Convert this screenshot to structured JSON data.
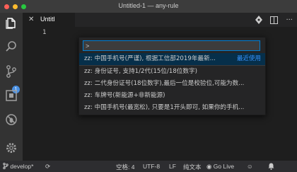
{
  "window": {
    "title": "Untitled-1 — any-rule"
  },
  "tab": {
    "label": "Untitl"
  },
  "editor": {
    "line_number": "1"
  },
  "quick_pick": {
    "input_value": ">",
    "recent_label": "最近使用",
    "items": [
      "zz: 中国手机号(严谨), 根据工信部2019年最新...",
      "zz: 身份证号, 支持1/2代(15位/18位数字)",
      "zz: 二代身份证号(18位数字),最后一位是校验位,可能为数...",
      "zz: 车牌号(新能源+非新能源)",
      "zz: 中国手机号(最宽松), 只要是1开头即可, 如果你的手机..."
    ]
  },
  "activity": {
    "scm_badge": "1"
  },
  "status": {
    "branch": "develop*",
    "spaces": "空格: 4",
    "encoding": "UTF-8",
    "eol": "LF",
    "language": "纯文本",
    "go_live": "Go Live"
  },
  "colors": {
    "accent": "#007fd4",
    "selection": "#062f4a",
    "badge": "#4a90e2",
    "recent": "#3794ff"
  }
}
